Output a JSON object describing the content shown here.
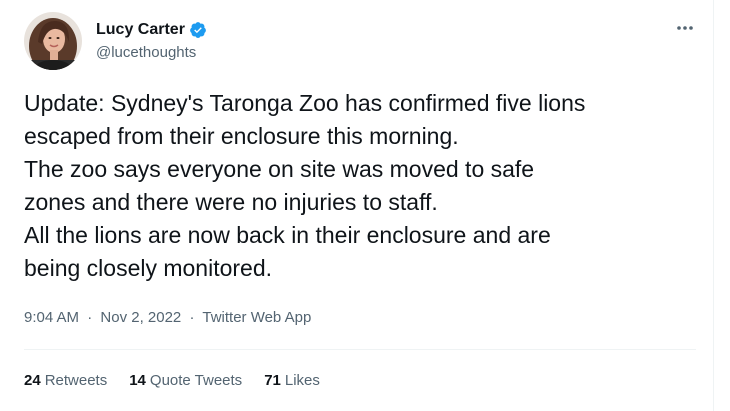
{
  "author": {
    "display_name": "Lucy Carter",
    "handle": "@lucethoughts",
    "verified_icon": "verified-badge-icon"
  },
  "colors": {
    "verified_blue": "#1d9bf0",
    "text_primary": "#0f1419",
    "text_secondary": "#536471",
    "divider": "#eff3f4"
  },
  "tweet": {
    "lines": [
      "Update: Sydney's Taronga Zoo has confirmed five lions",
      "escaped from their enclosure this morning.",
      "The zoo says everyone on site was moved to safe",
      "zones and there were no injuries to staff.",
      "All the lions are now back in their enclosure and are",
      "being closely monitored."
    ]
  },
  "meta": {
    "time": "9:04 AM",
    "separator": "·",
    "date": "Nov 2, 2022",
    "source": "Twitter Web App"
  },
  "stats": {
    "retweets_count": "24",
    "retweets_label": "Retweets",
    "quotes_count": "14",
    "quotes_label": "Quote Tweets",
    "likes_count": "71",
    "likes_label": "Likes"
  },
  "more_icon": "more-options-icon"
}
